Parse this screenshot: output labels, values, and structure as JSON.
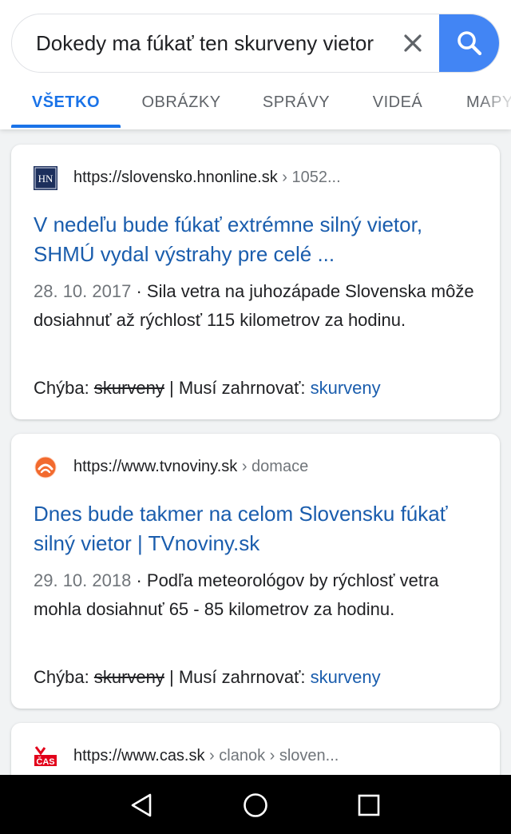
{
  "search": {
    "query": "Dokedy ma fúkať ten skurveny vietor",
    "clear_icon": "close-icon",
    "search_icon": "search-icon",
    "accent_color": "#4285f4"
  },
  "tabs": [
    {
      "label": "VŠETKO",
      "active": true
    },
    {
      "label": "OBRÁZKY",
      "active": false
    },
    {
      "label": "SPRÁVY",
      "active": false
    },
    {
      "label": "VIDEÁ",
      "active": false
    },
    {
      "label": "MAPY",
      "active": false
    }
  ],
  "results": [
    {
      "favicon": "hn-favicon",
      "favicon_text": "HN",
      "url": "https://slovensko.hnonline.sk",
      "breadcrumb": " › 1052...",
      "title": "V nedeľu bude fúkať extrémne silný vietor, SHMÚ vydal výstrahy pre celé ...",
      "date": "28. 10. 2017",
      "snippet": " · Sila vetra na juhozápade Slovenska môže dosiahnuť až rýchlosť 115 kilometrov za hodinu.",
      "missing_label": "Chýba: ",
      "missing_term": "skurveny",
      "must_label": " | Musí zahrnovať: ",
      "must_term": "skurveny"
    },
    {
      "favicon": "tvnoviny-favicon",
      "url": "https://www.tvnoviny.sk",
      "breadcrumb": " › domace",
      "title": "Dnes bude takmer na celom Slovensku fúkať silný vietor | TVnoviny.sk",
      "date": "29. 10. 2018",
      "snippet": " · Podľa meteorológov by rýchlosť vetra mohla dosiahnuť 65 - 85 kilometrov za hodinu.",
      "missing_label": "Chýba: ",
      "missing_term": "skurveny",
      "must_label": " | Musí zahrnovať: ",
      "must_term": "skurveny"
    },
    {
      "favicon": "cas-favicon",
      "favicon_text": "ČAS",
      "url": "https://www.cas.sk",
      "breadcrumb": " › clanok › sloven..."
    }
  ],
  "navbar": {
    "back_icon": "back-triangle-icon",
    "home_icon": "home-circle-icon",
    "recents_icon": "recents-square-icon"
  },
  "colors": {
    "link": "#1a5dad",
    "tab_active": "#1a73e8",
    "background": "#f1f3f4"
  }
}
